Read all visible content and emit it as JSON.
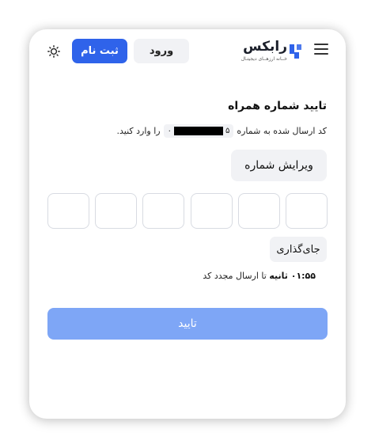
{
  "header": {
    "register_label": "ثبت نام",
    "login_label": "ورود",
    "logo_text": "رابکس",
    "logo_tagline": "خــانه ارزهــای دیجیتـال",
    "theme_icon": "sun-icon",
    "menu_icon": "hamburger-menu-icon"
  },
  "verify": {
    "title": "تایید شماره همراه",
    "instruction_before": "کد ارسال شده به شماره",
    "phone_start": "۰",
    "phone_end": "۵",
    "instruction_after": "را وارد کنید.",
    "edit_label": "ویرایش شماره",
    "otp_length": 6,
    "placeholder_label": "جای‌گذاری",
    "timer_value": "۰۱:۵۵ ثانیه",
    "timer_suffix": "تا ارسال مجدد کد",
    "confirm_label": "تایید"
  },
  "colors": {
    "primary": "#2f63ea",
    "primary_disabled": "#7ea6f6",
    "chip_bg": "#f1f2f5",
    "logo_mark": "#2f63ea"
  }
}
